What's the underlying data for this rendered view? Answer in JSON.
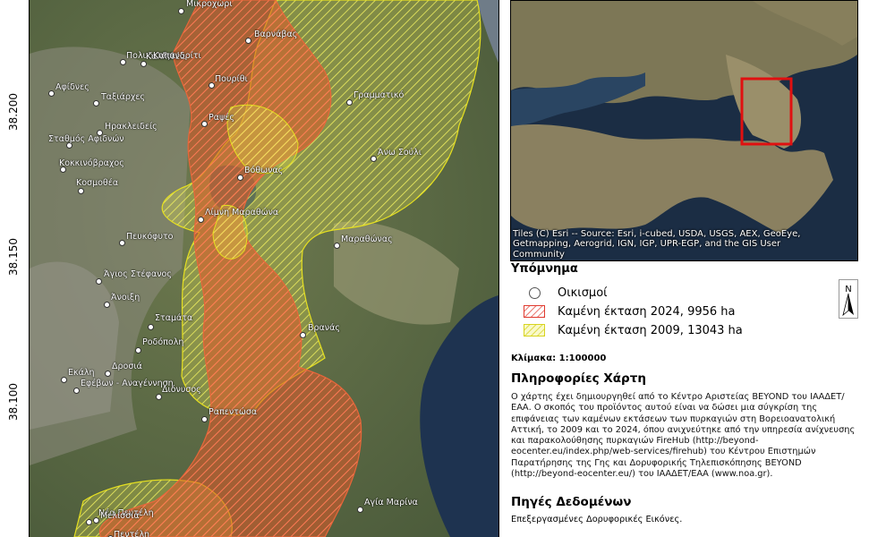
{
  "latitude_ticks": [
    "38.200",
    "38.150",
    "38.100"
  ],
  "places": [
    {
      "name": "Μικροχώρι"
    },
    {
      "name": "Βαρνάβας"
    },
    {
      "name": "Πολυδενδρι"
    },
    {
      "name": "Καλλιθέα"
    },
    {
      "name": "Καπανδρίτι"
    },
    {
      "name": "Αφίδνες"
    },
    {
      "name": "Ταξιάρχες"
    },
    {
      "name": "Πουρίθι"
    },
    {
      "name": "Γραμματικό"
    },
    {
      "name": "Ηρακλειδείς"
    },
    {
      "name": "Σταθμός Αφιδνών"
    },
    {
      "name": "Ραψές"
    },
    {
      "name": "Άνω Σούλι"
    },
    {
      "name": "Κοκκινόβραχος"
    },
    {
      "name": "Βόθωνας"
    },
    {
      "name": "Κοσμοθέα"
    },
    {
      "name": "Λίμνη Μαραθώνα"
    },
    {
      "name": "Πευκόφυτο"
    },
    {
      "name": "Μαραθώνας"
    },
    {
      "name": "Άγιος Στέφανος"
    },
    {
      "name": "Άνοιξη"
    },
    {
      "name": "Σταμάτα"
    },
    {
      "name": "Βρανάς"
    },
    {
      "name": "Ροδόπολη"
    },
    {
      "name": "Εκάλη"
    },
    {
      "name": "Δροσιά"
    },
    {
      "name": "Εφέβων - Αναγέννηση"
    },
    {
      "name": "Διόνυσος"
    },
    {
      "name": "Ραπεντώσα"
    },
    {
      "name": "Αγία Μαρίνα"
    },
    {
      "name": "Νέα Πεντέλη"
    },
    {
      "name": "Μελίσσια"
    },
    {
      "name": "Πεντέλη"
    }
  ],
  "inset": {
    "attribution": "Tiles (C) Esri -- Source: Esri, i-cubed, USDA, USGS, AEX, GeoEye, Getmapping, Aerogrid, IGN, IGP, UPR-EGP, and the GIS User Community"
  },
  "legend": {
    "title": "Υπόμνημα",
    "items": [
      {
        "label": "Οικισμοί",
        "symbol": "circle"
      },
      {
        "label": "Καμένη έκταση 2024, 9956 ha",
        "symbol": "hatch",
        "color": "#e03a2f"
      },
      {
        "label": "Καμένη έκταση 2009, 13043 ha",
        "symbol": "hatch",
        "color": "#e6e020"
      }
    ]
  },
  "north_arrow": {
    "label": "N"
  },
  "scale": "Κλίμακα: 1:100000",
  "info": {
    "title": "Πληροφορίες Χάρτη",
    "text": "Ο χάρτης έχει δημιουργηθεί από το Κέντρο Αριστείας BEYOND του ΙΑΑΔΕΤ/ΕΑΑ. Ο σκοπός του προϊόντος αυτού είναι να δώσει μια σύγκρίση της επιφάνειας των καμένων εκτάσεων των πυρκαγιών στη Βορειοανατολική Αττική, το 2009 και το 2024, όπου ανιχνεύτηκε από την υπηρεσία ανίχνευσης και παρακολούθησης πυρκαγιών FireHub (http://beyond-eocenter.eu/index.php/web-services/firehub) του Κέντρου Επιστημών Παρατήρησης της Γης και Δορυφορικής Τηλεπισκόπησης BEYOND (http://beyond-eocenter.eu/) του ΙΑΑΔΕΤ/ΕΑΑ (www.noa.gr)."
  },
  "sources": {
    "title": "Πηγές Δεδομένων",
    "text": "Επεξεργασμένες Δορυφορικές Εικόνες."
  },
  "colors": {
    "burn_2024": "#e03a2f",
    "burn_2009": "#e6e020",
    "inset_box": "#e01010"
  }
}
